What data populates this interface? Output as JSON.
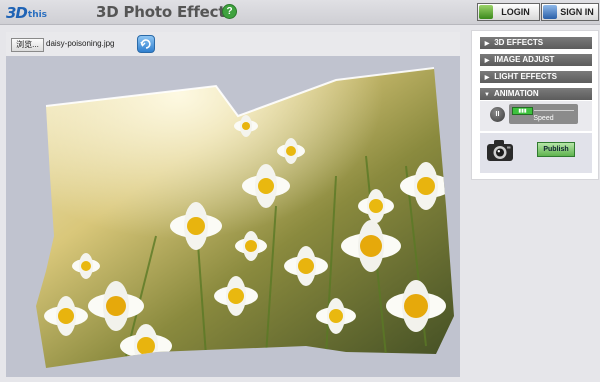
{
  "header": {
    "logo_main": "3D",
    "logo_sub": "this",
    "title": "3D Photo Effects",
    "help_label": "?",
    "login_label": "LOGIN",
    "signin_label": "SIGN IN"
  },
  "file": {
    "browse_label": "浏览...",
    "filename": "daisy-poisoning.jpg"
  },
  "panel": {
    "sections": [
      {
        "label": "3D EFFECTS",
        "icon": "triangle-right-icon",
        "expanded": false
      },
      {
        "label": "IMAGE ADJUST",
        "icon": "triangle-right-icon",
        "expanded": false
      },
      {
        "label": "LIGHT EFFECTS",
        "icon": "triangle-right-icon",
        "expanded": false
      },
      {
        "label": "ANIMATION",
        "icon": "triangle-down-icon",
        "expanded": true
      }
    ],
    "animation": {
      "pause_label": "II",
      "speed_label": "Speed",
      "speed_level": 0.3
    },
    "publish_label": "Publish"
  },
  "colors": {
    "accent_blue": "#1f63b5",
    "help_green": "#3fa23f",
    "section_bg": "#6a6a6a",
    "publish_green": "#5fb34f",
    "stage_bg": "#c0c3cf"
  }
}
